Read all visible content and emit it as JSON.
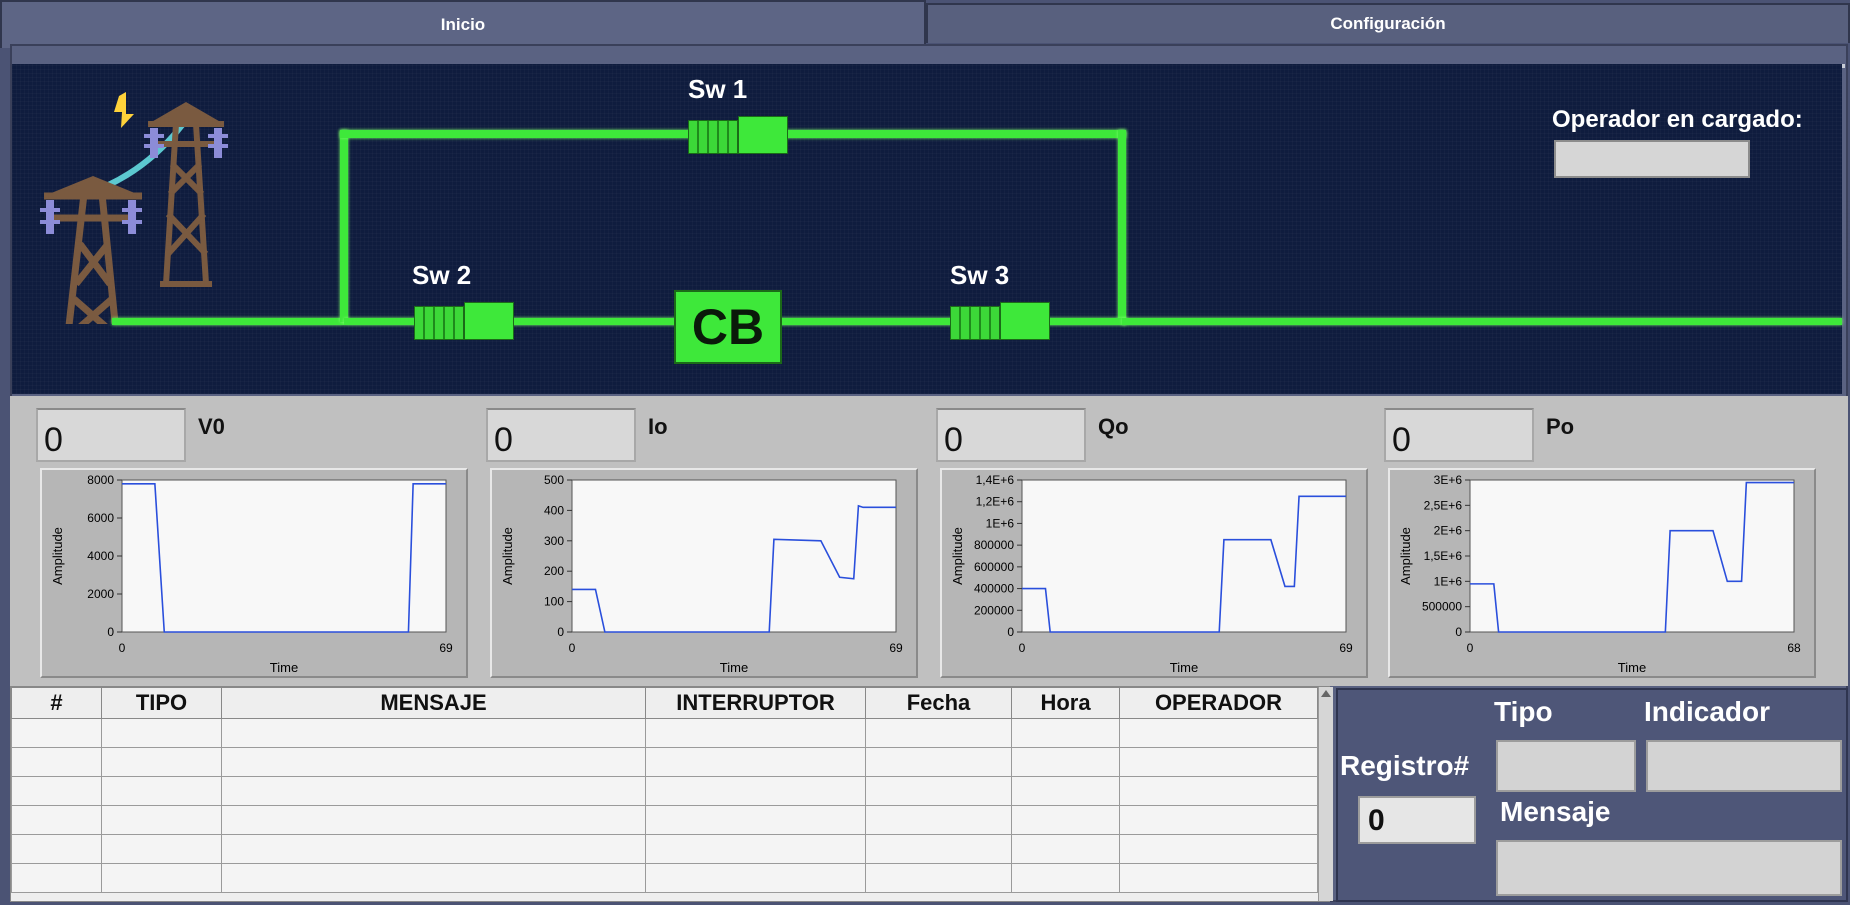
{
  "tabs": {
    "inicio": "Inicio",
    "configuracion": "Configuración"
  },
  "circuit": {
    "sw1": "Sw 1",
    "sw2": "Sw 2",
    "sw3": "Sw 3",
    "cb": "CB",
    "operator_label": "Operador en cargado:",
    "operator_value": ""
  },
  "meters": [
    {
      "label": "V0",
      "value": "0"
    },
    {
      "label": "Io",
      "value": "0"
    },
    {
      "label": "Qo",
      "value": "0"
    },
    {
      "label": "Po",
      "value": "0"
    }
  ],
  "chart_data": [
    {
      "type": "line",
      "xlabel": "Time",
      "ylabel": "Amplitude",
      "xlim": [
        0,
        69
      ],
      "ylim": [
        0,
        8000
      ],
      "yticks": [
        "8000",
        "6000",
        "4000",
        "2000",
        "0"
      ],
      "ytick_values": [
        8000,
        6000,
        4000,
        2000,
        0
      ],
      "xticks": [
        "0",
        "69"
      ],
      "x": [
        0,
        7,
        9,
        61,
        62,
        69
      ],
      "y": [
        7800,
        7800,
        0,
        0,
        7800,
        7800
      ]
    },
    {
      "type": "line",
      "xlabel": "Time",
      "ylabel": "Amplitude",
      "xlim": [
        0,
        69
      ],
      "ylim": [
        0,
        500
      ],
      "yticks": [
        "500",
        "400",
        "300",
        "200",
        "100",
        "0"
      ],
      "ytick_values": [
        500,
        400,
        300,
        200,
        100,
        0
      ],
      "xticks": [
        "0",
        "69"
      ],
      "x": [
        0,
        5,
        7,
        42,
        43,
        53,
        57,
        60,
        61,
        62,
        69
      ],
      "y": [
        140,
        140,
        0,
        0,
        305,
        300,
        180,
        175,
        415,
        410,
        410
      ]
    },
    {
      "type": "line",
      "xlabel": "Time",
      "ylabel": "Amplitude",
      "xlim": [
        0,
        69
      ],
      "ylim": [
        0,
        1400000
      ],
      "yticks": [
        "1,4E+6",
        "1,2E+6",
        "1E+6",
        "800000",
        "600000",
        "400000",
        "200000",
        "0"
      ],
      "ytick_values": [
        1400000,
        1200000,
        1000000,
        800000,
        600000,
        400000,
        200000,
        0
      ],
      "xticks": [
        "0",
        "69"
      ],
      "x": [
        0,
        5,
        6,
        42,
        43,
        53,
        56,
        58,
        59,
        60,
        69
      ],
      "y": [
        400000,
        400000,
        0,
        0,
        850000,
        850000,
        420000,
        420000,
        1250000,
        1250000,
        1250000
      ]
    },
    {
      "type": "line",
      "xlabel": "Time",
      "ylabel": "Amplitude",
      "xlim": [
        0,
        68
      ],
      "ylim": [
        0,
        3000000
      ],
      "yticks": [
        "3E+6",
        "2,5E+6",
        "2E+6",
        "1,5E+6",
        "1E+6",
        "500000",
        "0"
      ],
      "ytick_values": [
        3000000,
        2500000,
        2000000,
        1500000,
        1000000,
        500000,
        0
      ],
      "xticks": [
        "0",
        "68"
      ],
      "x": [
        0,
        5,
        6,
        41,
        42,
        51,
        54,
        57,
        58,
        59,
        68
      ],
      "y": [
        950000,
        950000,
        0,
        0,
        2000000,
        2000000,
        1000000,
        1000000,
        2950000,
        2950000,
        2950000
      ]
    }
  ],
  "table": {
    "headers": [
      "#",
      "TIPO",
      "MENSAJE",
      "INTERRUPTOR",
      "Fecha",
      "Hora",
      "OPERADOR"
    ],
    "rows": 6
  },
  "record": {
    "registro_label": "Registro#",
    "registro_value": "0",
    "tipo_label": "Tipo",
    "indicador_label": "Indicador",
    "mensaje_label": "Mensaje"
  },
  "colors": {
    "wire": "#3ee83a",
    "circuit_bg": "#0f1c3e",
    "panel": "#5a6282",
    "plot_line": "#2a4fdc"
  }
}
